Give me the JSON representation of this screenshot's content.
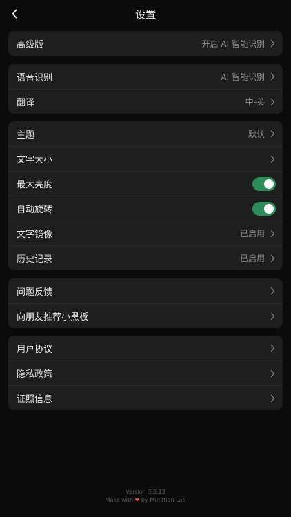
{
  "header": {
    "title": "设置"
  },
  "groups": [
    {
      "rows": [
        {
          "label": "高级版",
          "value": "开启 AI 智能识别"
        }
      ]
    },
    {
      "rows": [
        {
          "label": "语音识别",
          "value": "AI 智能识别"
        },
        {
          "label": "翻译",
          "value": "中-英"
        }
      ]
    },
    {
      "rows": [
        {
          "label": "主题",
          "value": "默认"
        },
        {
          "label": "文字大小",
          "value": ""
        },
        {
          "label": "最大亮度",
          "toggle": true
        },
        {
          "label": "自动旋转",
          "toggle": true
        },
        {
          "label": "文字镜像",
          "value": "已启用"
        },
        {
          "label": "历史记录",
          "value": "已启用"
        }
      ]
    },
    {
      "rows": [
        {
          "label": "问题反馈"
        },
        {
          "label": "向朋友推荐小黑板"
        }
      ]
    },
    {
      "rows": [
        {
          "label": "用户协议"
        },
        {
          "label": "隐私政策"
        },
        {
          "label": "证照信息"
        }
      ]
    }
  ],
  "footer": {
    "version": "Version 3.0.13",
    "made_prefix": "Make with",
    "made_suffix": "by Mutation Lab"
  },
  "colors": {
    "toggle_on": "#2e8c5a",
    "card_bg": "#1e1e1e",
    "page_bg": "#0b0b0b"
  },
  "icons": {
    "back": "chevron-left-icon",
    "row_arrow": "chevron-right-icon",
    "heart": "heart-icon"
  }
}
